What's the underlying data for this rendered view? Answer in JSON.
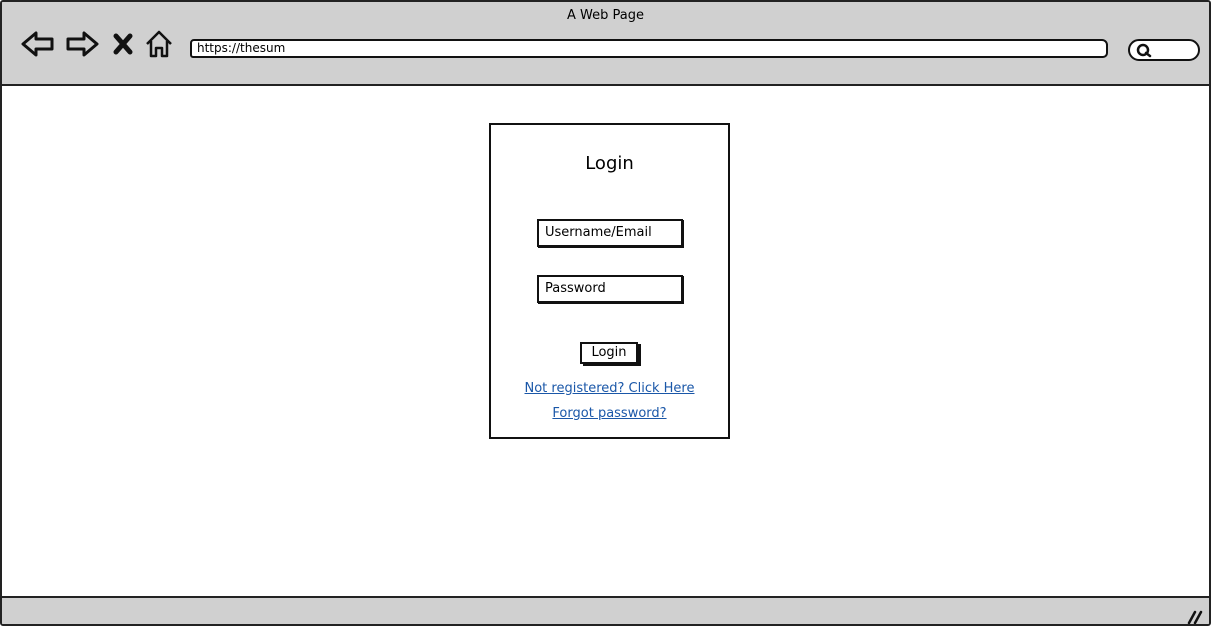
{
  "window": {
    "title": "A Web Page"
  },
  "toolbar": {
    "back_icon": "back-arrow-icon",
    "forward_icon": "forward-arrow-icon",
    "stop_icon": "close-icon",
    "home_icon": "home-icon",
    "url": "https://thesum",
    "search_icon": "search-icon"
  },
  "login": {
    "title": "Login",
    "username_placeholder": "Username/Email",
    "password_placeholder": "Password",
    "button_label": "Login",
    "register_link": "Not registered? Click Here",
    "forgot_link": "Forgot password?"
  },
  "colors": {
    "chrome": "#d0d0d0",
    "link": "#1a57a8"
  }
}
